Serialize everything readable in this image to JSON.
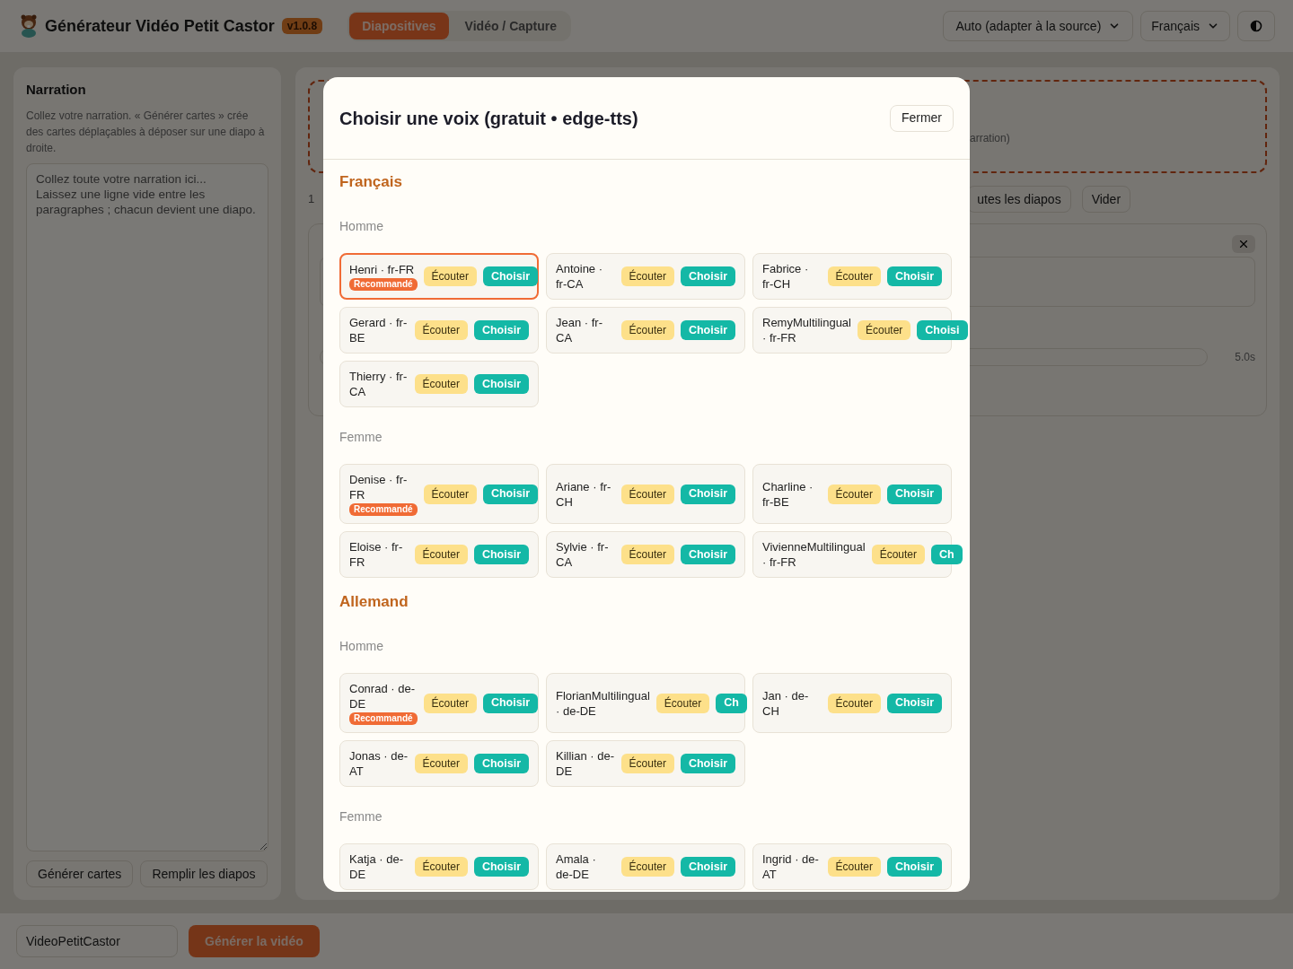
{
  "header": {
    "title": "Générateur Vidéo Petit Castor",
    "version": "v1.0.8",
    "tabs": [
      {
        "label": "Diapositives",
        "selected": true
      },
      {
        "label": "Vidéo / Capture",
        "selected": false
      }
    ],
    "quality_select": "Auto (adapter à la source)",
    "language_select": "Français"
  },
  "narration": {
    "title": "Narration",
    "description": "Collez votre narration. « Générer cartes » crée des cartes déplaçables à déposer sur une diapo à droite.",
    "placeholder": "Collez toute votre narration ici...\nLaissez une ligne vide entre les paragraphes ; chacun devient une diapo.",
    "buttons": [
      "Générer cartes",
      "Remplir les diapos"
    ]
  },
  "slides_panel": {
    "dropzone_text": "arration)",
    "count_text": "1",
    "buttons": [
      "utes les diapos",
      "Vider"
    ],
    "duration": "5.0s"
  },
  "footer": {
    "project_name": "VideoPetitCastor",
    "generate_button": "Générer la vidéo"
  },
  "modal": {
    "title": "Choisir une voix (gratuit • edge-tts)",
    "close_button": "Fermer",
    "languages": [
      {
        "name": "Français",
        "groups": [
          {
            "label": "Homme",
            "voices": [
              {
                "name": "Henri · fr-FR",
                "badge": "Recommandé",
                "selected": true,
                "listen": "Écouter",
                "choose": "Choisir"
              },
              {
                "name": "Antoine · fr-CA",
                "selected": false,
                "listen": "Écouter",
                "choose": "Choisir"
              },
              {
                "name": "Fabrice · fr-CH",
                "selected": false,
                "listen": "Écouter",
                "choose": "Choisir"
              },
              {
                "name": "Gerard · fr-BE",
                "selected": false,
                "listen": "Écouter",
                "choose": "Choisir"
              },
              {
                "name": "Jean · fr-CA",
                "selected": false,
                "listen": "Écouter",
                "choose": "Choisir"
              },
              {
                "name": "RemyMultilingual · fr-FR",
                "selected": false,
                "listen": "Écouter",
                "choose": "Choisi"
              },
              {
                "name": "Thierry · fr-CA",
                "selected": false,
                "listen": "Écouter",
                "choose": "Choisir"
              }
            ]
          },
          {
            "label": "Femme",
            "voices": [
              {
                "name": "Denise · fr-FR",
                "badge": "Recommandé",
                "selected": false,
                "listen": "Écouter",
                "choose": "Choisir"
              },
              {
                "name": "Ariane · fr-CH",
                "selected": false,
                "listen": "Écouter",
                "choose": "Choisir"
              },
              {
                "name": "Charline · fr-BE",
                "selected": false,
                "listen": "Écouter",
                "choose": "Choisir"
              },
              {
                "name": "Eloise · fr-FR",
                "selected": false,
                "listen": "Écouter",
                "choose": "Choisir"
              },
              {
                "name": "Sylvie · fr-CA",
                "selected": false,
                "listen": "Écouter",
                "choose": "Choisir"
              },
              {
                "name": "VivienneMultilingual · fr-FR",
                "selected": false,
                "listen": "Écouter",
                "choose": "Ch"
              }
            ]
          }
        ]
      },
      {
        "name": "Allemand",
        "groups": [
          {
            "label": "Homme",
            "voices": [
              {
                "name": "Conrad · de-DE",
                "badge": "Recommandé",
                "selected": false,
                "listen": "Écouter",
                "choose": "Choisir"
              },
              {
                "name": "FlorianMultilingual · de-DE",
                "selected": false,
                "listen": "Écouter",
                "choose": "Ch"
              },
              {
                "name": "Jan · de-CH",
                "selected": false,
                "listen": "Écouter",
                "choose": "Choisir"
              },
              {
                "name": "Jonas · de-AT",
                "selected": false,
                "listen": "Écouter",
                "choose": "Choisir"
              },
              {
                "name": "Killian · de-DE",
                "selected": false,
                "listen": "Écouter",
                "choose": "Choisir"
              }
            ]
          },
          {
            "label": "Femme",
            "voices": [
              {
                "name": "Katja · de-DE",
                "selected": false,
                "listen": "Écouter",
                "choose": "Choisir"
              },
              {
                "name": "Amala · de-DE",
                "selected": false,
                "listen": "Écouter",
                "choose": "Choisir"
              },
              {
                "name": "Ingrid · de-AT",
                "selected": false,
                "listen": "Écouter",
                "choose": "Choisir"
              }
            ]
          }
        ]
      }
    ]
  }
}
